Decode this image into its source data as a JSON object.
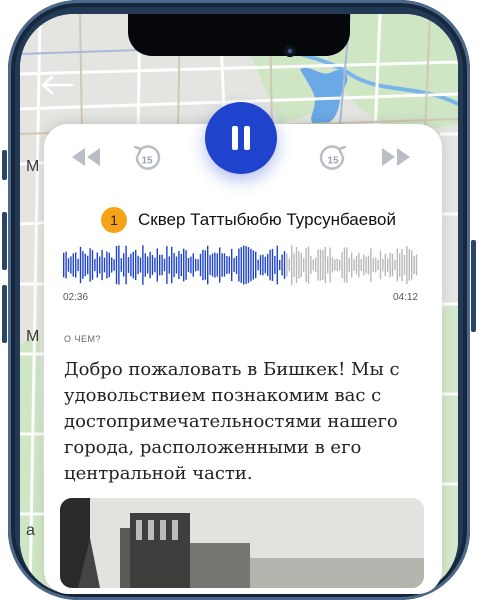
{
  "map": {
    "visible_labels": [
      "M",
      "M",
      "a"
    ]
  },
  "player": {
    "state": "playing",
    "progress": 0.63,
    "elapsed": "02:36",
    "total": "04:12",
    "skip_seconds": "15",
    "accent_color": "#1f43cc"
  },
  "track": {
    "number": "1",
    "name": "Сквер Таттыбюбю Турсунбаевой",
    "badge_color": "#f6a31a"
  },
  "about": {
    "label": "О ЧЕМ?",
    "text": "Добро пожаловать в Бишкек! Мы с удовольствием познакомим вас с достопримечательностями нашего города, расположенными в его центральной части."
  },
  "icons": {
    "back": "arrow-left-icon",
    "rewind": "rewind-icon",
    "skip_back": "replay-15-icon",
    "pause": "pause-icon",
    "skip_forward": "forward-15-icon",
    "fast_forward": "fast-forward-icon"
  }
}
